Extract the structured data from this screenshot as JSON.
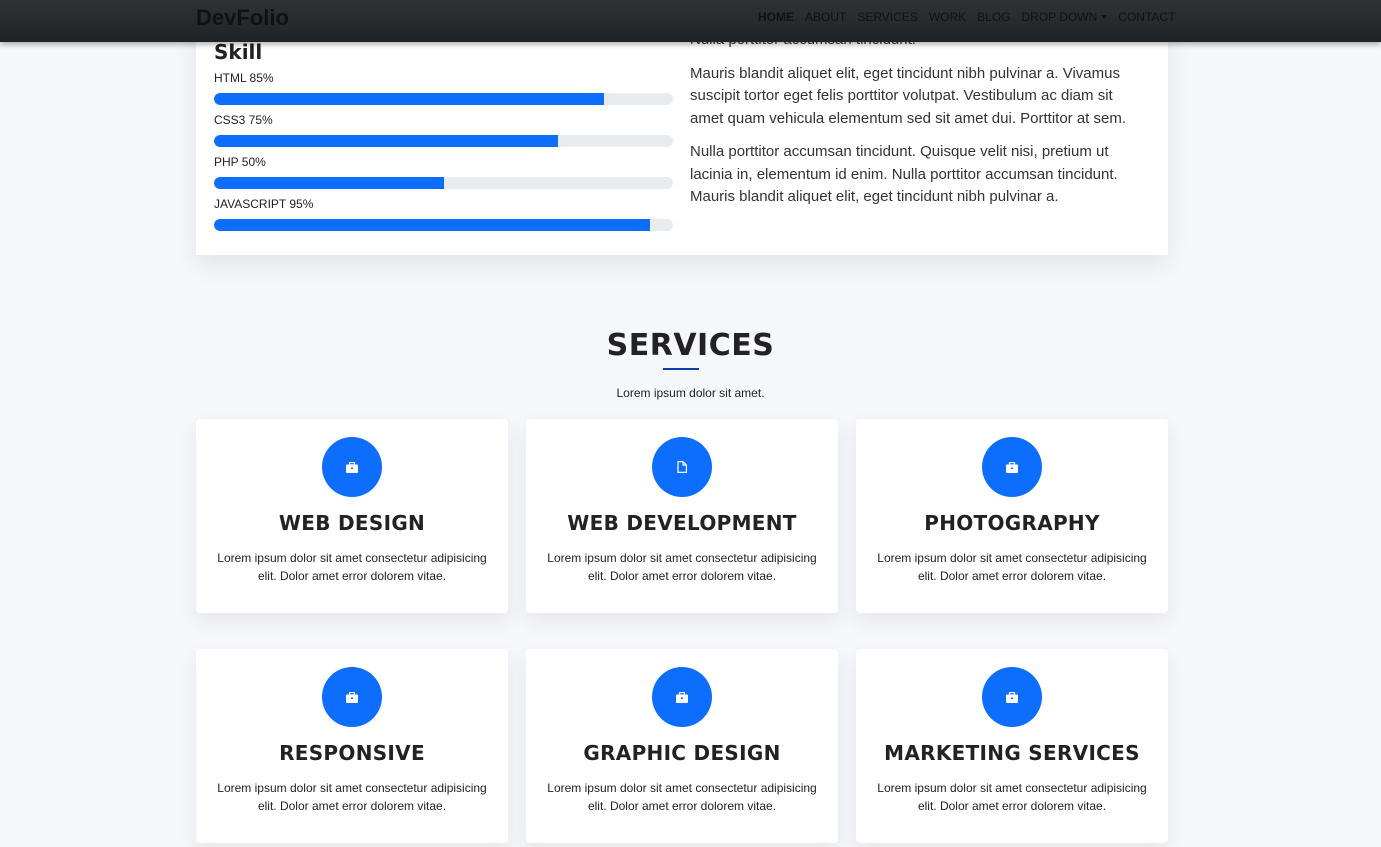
{
  "brand": "DevFolio",
  "nav": {
    "items": [
      "HOME",
      "ABOUT",
      "SERVICES",
      "WORK",
      "BLOG",
      "DROP DOWN",
      "CONTACT"
    ],
    "active": "HOME"
  },
  "about": {
    "skill_title": "Skill",
    "skills": [
      {
        "label": "HTML 85%",
        "percent": 85
      },
      {
        "label": "CSS3 75%",
        "percent": 75
      },
      {
        "label": "PHP 50%",
        "percent": 50
      },
      {
        "label": "JAVASCRIPT 95%",
        "percent": 95
      }
    ],
    "paragraphs": [
      "Nulla porttitor accumsan tincidunt.",
      "Mauris blandit aliquet elit, eget tincidunt nibh pulvinar a. Vivamus suscipit tortor eget felis porttitor volutpat. Vestibulum ac diam sit amet quam vehicula elementum sed sit amet dui. Porttitor at sem.",
      "Nulla porttitor accumsan tincidunt. Quisque velit nisi, pretium ut lacinia in, elementum id enim. Nulla porttitor accumsan tincidunt. Mauris blandit aliquet elit, eget tincidunt nibh pulvinar a."
    ]
  },
  "services": {
    "title": "SERVICES",
    "subtitle": "Lorem ipsum dolor sit amet.",
    "items": [
      {
        "name": "WEB DESIGN",
        "icon": "briefcase-icon",
        "desc": "Lorem ipsum dolor sit amet consectetur adipisicing elit. Dolor amet error dolorem vitae."
      },
      {
        "name": "WEB DEVELOPMENT",
        "icon": "file-icon",
        "desc": "Lorem ipsum dolor sit amet consectetur adipisicing elit. Dolor amet error dolorem vitae."
      },
      {
        "name": "PHOTOGRAPHY",
        "icon": "briefcase-icon",
        "desc": "Lorem ipsum dolor sit amet consectetur adipisicing elit. Dolor amet error dolorem vitae."
      },
      {
        "name": "RESPONSIVE",
        "icon": "briefcase-icon",
        "desc": "Lorem ipsum dolor sit amet consectetur adipisicing elit. Dolor amet error dolorem vitae."
      },
      {
        "name": "GRAPHIC DESIGN",
        "icon": "briefcase-icon",
        "desc": "Lorem ipsum dolor sit amet consectetur adipisicing elit. Dolor amet error dolorem vitae."
      },
      {
        "name": "MARKETING SERVICES",
        "icon": "briefcase-icon",
        "desc": "Lorem ipsum dolor sit amet consectetur adipisicing elit. Dolor amet error dolorem vitae."
      }
    ]
  },
  "colors": {
    "accent": "#0d6efd",
    "title_underline": "#0d3fa8"
  }
}
